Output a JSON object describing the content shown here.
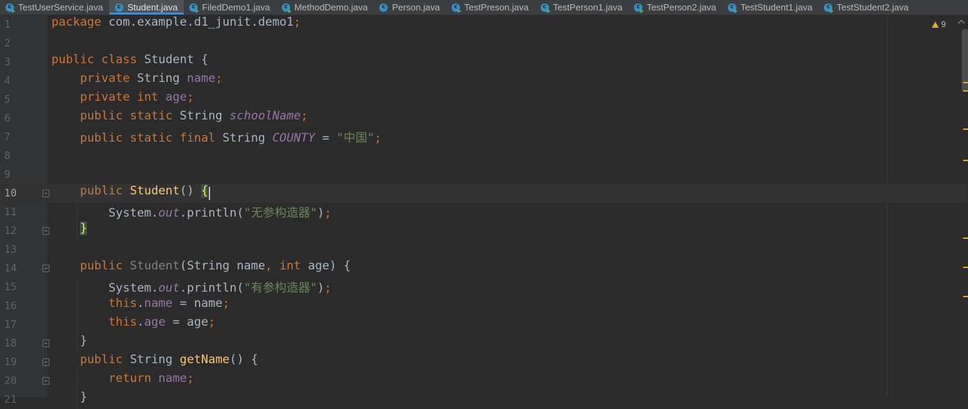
{
  "tabs": [
    {
      "label": "TestUserService.java",
      "run": true,
      "active": false
    },
    {
      "label": "Student.java",
      "run": false,
      "active": true
    },
    {
      "label": "FiledDemo1.java",
      "run": true,
      "active": false
    },
    {
      "label": "MethodDemo.java",
      "run": true,
      "active": false
    },
    {
      "label": "Person.java",
      "run": false,
      "active": false
    },
    {
      "label": "TestPreson.java",
      "run": true,
      "active": false
    },
    {
      "label": "TestPerson1.java",
      "run": true,
      "active": false
    },
    {
      "label": "TestPerson2.java",
      "run": true,
      "active": false
    },
    {
      "label": "TestStudent1.java",
      "run": true,
      "active": false
    },
    {
      "label": "TestStudent2.java",
      "run": true,
      "active": false
    }
  ],
  "inspections": {
    "warnings": "9"
  },
  "colors": {
    "keyword": "#cc7832",
    "plain": "#a9b7c6",
    "field": "#9876aa",
    "string": "#6a8759",
    "method": "#ffc66d",
    "warning": "#e0a92f",
    "background": "#2b2b2b"
  },
  "code_lines": [
    {
      "n": "1",
      "tokens": [
        [
          "kw",
          "package "
        ],
        [
          "pl",
          "com.example.d1_junit.demo1"
        ],
        [
          "kw",
          ";"
        ]
      ]
    },
    {
      "n": "2",
      "tokens": []
    },
    {
      "n": "3",
      "tokens": [
        [
          "kw",
          "public class "
        ],
        [
          "pl",
          "Student {"
        ]
      ]
    },
    {
      "n": "4",
      "tokens": [
        [
          "pl",
          "    "
        ],
        [
          "kw",
          "private "
        ],
        [
          "pl",
          "String "
        ],
        [
          "fd",
          "name"
        ],
        [
          "kw",
          ";"
        ]
      ]
    },
    {
      "n": "5",
      "tokens": [
        [
          "pl",
          "    "
        ],
        [
          "kw",
          "private int "
        ],
        [
          "fd",
          "age"
        ],
        [
          "kw",
          ";"
        ]
      ]
    },
    {
      "n": "6",
      "tokens": [
        [
          "pl",
          "    "
        ],
        [
          "kw",
          "public static "
        ],
        [
          "pl",
          "String "
        ],
        [
          "sf",
          "schoolName"
        ],
        [
          "kw",
          ";"
        ]
      ]
    },
    {
      "n": "7",
      "tokens": [
        [
          "pl",
          "    "
        ],
        [
          "kw",
          "public static final "
        ],
        [
          "pl",
          "String "
        ],
        [
          "sf",
          "COUNTY"
        ],
        [
          "pl",
          " = "
        ],
        [
          "st",
          "\"中国\""
        ],
        [
          "kw",
          ";"
        ]
      ]
    },
    {
      "n": "8",
      "tokens": []
    },
    {
      "n": "9",
      "tokens": []
    },
    {
      "n": "10",
      "current": true,
      "fold": true,
      "tokens": [
        [
          "pl",
          "    "
        ],
        [
          "kw",
          "public "
        ],
        [
          "mf",
          "Student"
        ],
        [
          "pl",
          "() "
        ],
        [
          "br",
          "{"
        ]
      ]
    },
    {
      "n": "11",
      "tokens": [
        [
          "pl",
          "        System."
        ],
        [
          "sf",
          "out"
        ],
        [
          "pl",
          ".println("
        ],
        [
          "st",
          "\"无参构造器\""
        ],
        [
          "pl",
          ")"
        ],
        [
          "kw",
          ";"
        ]
      ]
    },
    {
      "n": "12",
      "fold": true,
      "tokens": [
        [
          "pl",
          "    "
        ],
        [
          "br",
          "}"
        ]
      ]
    },
    {
      "n": "13",
      "tokens": []
    },
    {
      "n": "14",
      "fold": true,
      "tokens": [
        [
          "pl",
          "    "
        ],
        [
          "kw",
          "public "
        ],
        [
          "gr",
          "Student"
        ],
        [
          "pl",
          "(String name"
        ],
        [
          "kw",
          ", int "
        ],
        [
          "pl",
          "age) {"
        ]
      ]
    },
    {
      "n": "15",
      "tokens": [
        [
          "pl",
          "        System."
        ],
        [
          "sf",
          "out"
        ],
        [
          "pl",
          ".println("
        ],
        [
          "st",
          "\"有参构造器\""
        ],
        [
          "pl",
          ")"
        ],
        [
          "kw",
          ";"
        ]
      ]
    },
    {
      "n": "16",
      "tokens": [
        [
          "pl",
          "        "
        ],
        [
          "kw",
          "this"
        ],
        [
          "pl",
          "."
        ],
        [
          "fd",
          "name"
        ],
        [
          "pl",
          " = name"
        ],
        [
          "kw",
          ";"
        ]
      ]
    },
    {
      "n": "17",
      "tokens": [
        [
          "pl",
          "        "
        ],
        [
          "kw",
          "this"
        ],
        [
          "pl",
          "."
        ],
        [
          "fd",
          "age"
        ],
        [
          "pl",
          " = age"
        ],
        [
          "kw",
          ";"
        ]
      ]
    },
    {
      "n": "18",
      "fold": true,
      "tokens": [
        [
          "pl",
          "    }"
        ]
      ]
    },
    {
      "n": "19",
      "fold": true,
      "tokens": [
        [
          "pl",
          "    "
        ],
        [
          "kw",
          "public "
        ],
        [
          "pl",
          "String "
        ],
        [
          "mf",
          "getName"
        ],
        [
          "pl",
          "() {"
        ]
      ]
    },
    {
      "n": "20",
      "fold": true,
      "tokens": [
        [
          "pl",
          "        "
        ],
        [
          "kw",
          "return "
        ],
        [
          "fd",
          "name"
        ],
        [
          "kw",
          ";"
        ]
      ]
    },
    {
      "n": "21",
      "tokens": [
        [
          "pl",
          "    }"
        ]
      ]
    }
  ]
}
